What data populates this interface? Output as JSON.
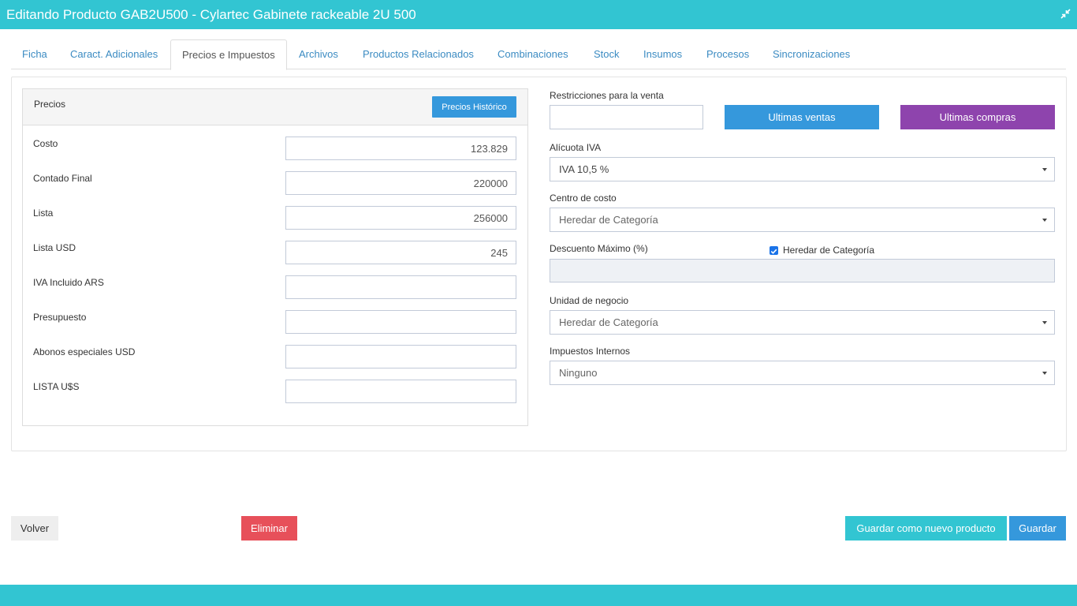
{
  "window": {
    "title": "Editando Producto GAB2U500 - Cylartec Gabinete rackeable 2U 500"
  },
  "tabs": [
    {
      "label": "Ficha"
    },
    {
      "label": "Caract. Adicionales"
    },
    {
      "label": "Precios e Impuestos"
    },
    {
      "label": "Archivos"
    },
    {
      "label": "Productos Relacionados"
    },
    {
      "label": "Combinaciones"
    },
    {
      "label": "Stock"
    },
    {
      "label": "Insumos"
    },
    {
      "label": "Procesos"
    },
    {
      "label": "Sincronizaciones"
    }
  ],
  "active_tab": "Precios e Impuestos",
  "prices": {
    "title": "Precios",
    "history_button": "Precios Histórico",
    "rows": [
      {
        "label": "Costo",
        "value": "123.829"
      },
      {
        "label": "Contado Final",
        "value": "220000"
      },
      {
        "label": "Lista",
        "value": "256000"
      },
      {
        "label": "Lista USD",
        "value": "245"
      },
      {
        "label": "IVA Incluido ARS",
        "value": ""
      },
      {
        "label": "Presupuesto",
        "value": ""
      },
      {
        "label": "Abonos especiales USD",
        "value": ""
      },
      {
        "label": "LISTA U$S",
        "value": ""
      }
    ]
  },
  "right": {
    "restrictions_label": "Restricciones para la venta",
    "restrictions_value": "",
    "last_sales_button": "Ultimas ventas",
    "last_purchases_button": "Ultimas compras",
    "iva_label": "Alícuota IVA",
    "iva_value": "IVA 10,5 %",
    "cost_center_label": "Centro de costo",
    "cost_center_value": "Heredar de Categoría",
    "max_discount_label": "Descuento Máximo (%)",
    "inherit_checkbox_label": "Heredar de Categoría",
    "inherit_checked": true,
    "max_discount_value": "",
    "business_unit_label": "Unidad de negocio",
    "business_unit_value": "Heredar de Categoría",
    "internal_taxes_label": "Impuestos Internos",
    "internal_taxes_value": "Ninguno"
  },
  "footer": {
    "back_button": "Volver",
    "delete_button": "Eliminar",
    "save_as_new_button": "Guardar como nuevo producto",
    "save_button": "Guardar"
  },
  "colors": {
    "header": "#32c5d2",
    "primary": "#3598dc",
    "purple": "#8e44ad",
    "danger": "#e7505a",
    "teal": "#32c5d2"
  }
}
